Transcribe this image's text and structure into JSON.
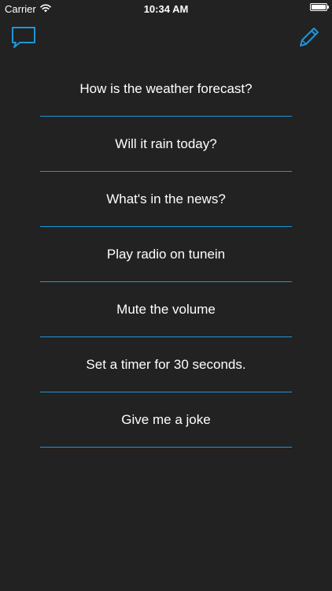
{
  "status_bar": {
    "carrier": "Carrier",
    "time": "10:34 AM",
    "battery_level": 1.0
  },
  "nav": {
    "left_icon": "chat-bubble-icon",
    "right_icon": "pencil-icon",
    "accent_color": "#1e96d8"
  },
  "commands": [
    {
      "label": "How is the weather forecast?"
    },
    {
      "label": "Will it rain today?"
    },
    {
      "label": "What's in the news?"
    },
    {
      "label": "Play radio on tunein"
    },
    {
      "label": "Mute the volume"
    },
    {
      "label": "Set a timer for 30 seconds."
    },
    {
      "label": "Give me a joke"
    }
  ]
}
